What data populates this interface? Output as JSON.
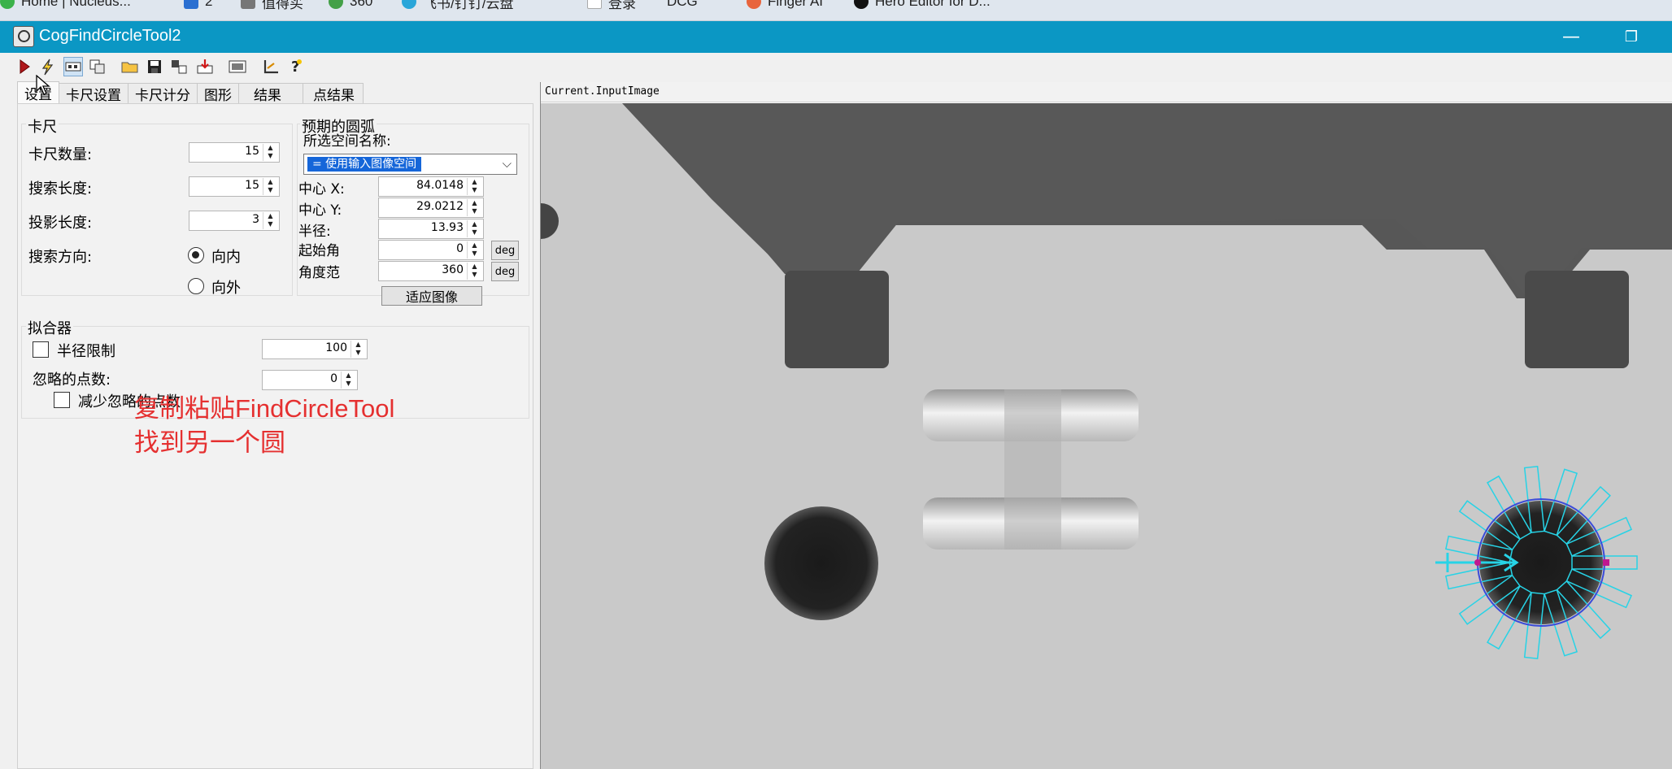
{
  "browser_bar": {
    "bookmarks": [
      "Home | Nucleus...",
      "2",
      "值得买",
      "360",
      "飞书/钉钉/云盘",
      "登录",
      "DCG",
      "Finger AI",
      "Hero Editor for D..."
    ]
  },
  "window": {
    "title": "CogFindCircleTool2",
    "minimize_glyph": "—",
    "restore_glyph": "❐"
  },
  "tabs": [
    "设置",
    "卡尺设置",
    "卡尺计分",
    "图形",
    "结果",
    "点结果"
  ],
  "caliper": {
    "group_title": "卡尺",
    "count_label": "卡尺数量:",
    "count_value": "15",
    "search_length_label": "搜索长度:",
    "search_length_value": "15",
    "projection_length_label": "投影长度:",
    "projection_length_value": "3",
    "direction_label": "搜索方向:",
    "direction_inward": "向内",
    "direction_outward": "向外"
  },
  "expected_arc": {
    "group_title": "预期的圆弧",
    "space_label": "所选空间名称:",
    "space_value": "= 使用输入图像空间",
    "center_x_label": "中心 X:",
    "center_x_value": "84.0148",
    "center_y_label": "中心 Y:",
    "center_y_value": "29.0212",
    "radius_label": "半径:",
    "radius_value": "13.93",
    "start_angle_label": "起始角",
    "start_angle_value": "0",
    "angle_span_label": "角度范",
    "angle_span_value": "360",
    "deg_label": "deg",
    "fit_button": "适应图像"
  },
  "fitter": {
    "group_title": "拟合器",
    "radius_limit_label": "半径限制",
    "radius_limit_value": "100",
    "ignore_points_label": "忽略的点数:",
    "ignore_points_value": "0",
    "reduce_ignore_label": "减少忽略的点数"
  },
  "annotation": {
    "line1": "复制粘贴FindCircleTool",
    "line2": "找到另一个圆"
  },
  "viewer": {
    "title": "Current.InputImage"
  }
}
